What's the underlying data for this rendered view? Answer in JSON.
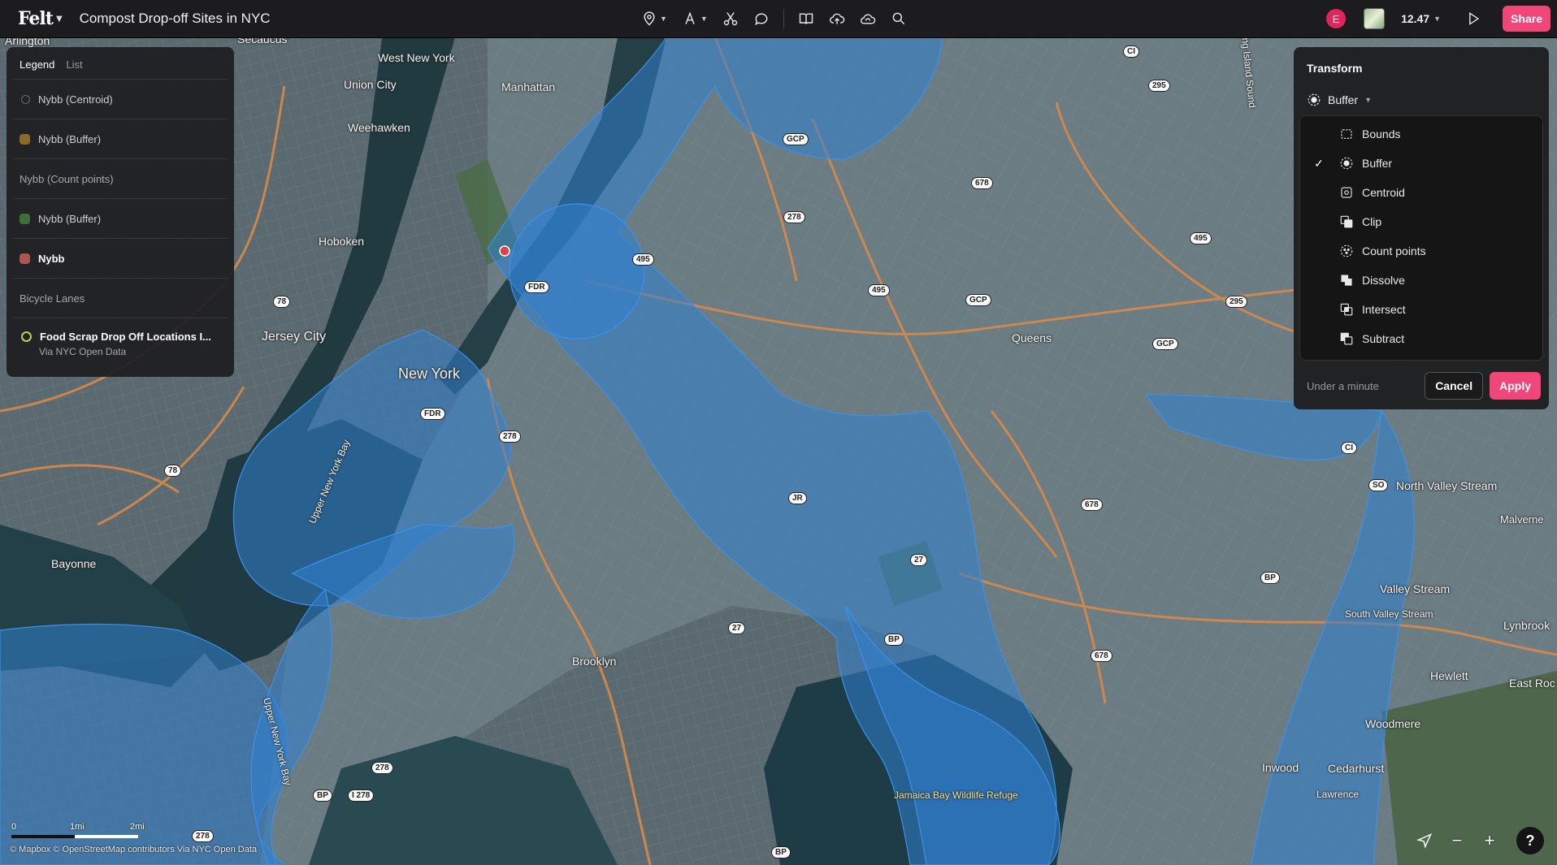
{
  "app": {
    "logo": "Felt",
    "map_title": "Compost Drop-off Sites in NYC"
  },
  "toolbar": {
    "icons": [
      "pin-icon",
      "text-icon",
      "scissors-icon",
      "comment-icon",
      "book-icon",
      "upload-icon",
      "cloud-icon",
      "search-icon"
    ]
  },
  "header_right": {
    "avatar_initial": "E",
    "zoom": "12.47",
    "share_label": "Share"
  },
  "legend": {
    "tabs": [
      {
        "label": "Legend",
        "active": true
      },
      {
        "label": "List",
        "active": false
      }
    ],
    "layers": [
      {
        "label": "Nybb (Centroid)",
        "swatch": "circle-outline"
      },
      {
        "label": "Nybb (Buffer)",
        "swatch": "#8a6a2a"
      },
      {
        "label": "Nybb (Count points)",
        "group": true
      },
      {
        "label": "Nybb (Buffer)",
        "swatch": "#3f6e3a"
      },
      {
        "label": "Nybb",
        "swatch": "#a8574d",
        "bold": true
      },
      {
        "label": "Bicycle Lanes",
        "group": true
      },
      {
        "label": "Food Scrap Drop Off Locations I...",
        "sub": "Via NYC Open Data",
        "swatch": "circle-green"
      }
    ]
  },
  "transform": {
    "title": "Transform",
    "selected_op": "Buffer",
    "operations": [
      {
        "label": "Bounds",
        "icon": "bounds-icon",
        "checked": false
      },
      {
        "label": "Buffer",
        "icon": "buffer-icon",
        "checked": true
      },
      {
        "label": "Centroid",
        "icon": "centroid-icon",
        "checked": false
      },
      {
        "label": "Clip",
        "icon": "clip-icon",
        "checked": false
      },
      {
        "label": "Count points",
        "icon": "count-points-icon",
        "checked": false
      },
      {
        "label": "Dissolve",
        "icon": "dissolve-icon",
        "checked": false
      },
      {
        "label": "Intersect",
        "icon": "intersect-icon",
        "checked": false
      },
      {
        "label": "Subtract",
        "icon": "subtract-icon",
        "checked": false
      }
    ],
    "duration": "Under a minute",
    "cancel_label": "Cancel",
    "apply_label": "Apply"
  },
  "map": {
    "places": [
      {
        "text": "Arlington"
      },
      {
        "text": "Secaucus"
      },
      {
        "text": "West New York"
      },
      {
        "text": "Union City"
      },
      {
        "text": "Manhattan"
      },
      {
        "text": "Weehawken"
      },
      {
        "text": "Hoboken"
      },
      {
        "text": "Jersey City"
      },
      {
        "text": "New York"
      },
      {
        "text": "Queens"
      },
      {
        "text": "Bayonne"
      },
      {
        "text": "Brooklyn"
      },
      {
        "text": "Upper New York Bay"
      },
      {
        "text": "Upper New York Bay"
      },
      {
        "text": "Long Island Sound"
      },
      {
        "text": "North Valley Stream"
      },
      {
        "text": "Malverne"
      },
      {
        "text": "Valley Stream"
      },
      {
        "text": "South Valley Stream"
      },
      {
        "text": "Lynbrook"
      },
      {
        "text": "Hewlett"
      },
      {
        "text": "East Roc"
      },
      {
        "text": "Woodmere"
      },
      {
        "text": "Inwood"
      },
      {
        "text": "Cedarhurst"
      },
      {
        "text": "Lawrence"
      },
      {
        "text": "Jamaica Bay Wildlife Refuge"
      }
    ],
    "shields": [
      "CI",
      "295",
      "GCP",
      "678",
      "278",
      "495",
      "FDR",
      "495",
      "495",
      "GCP",
      "295",
      "GCP",
      "78",
      "FDR",
      "278",
      "78",
      "JR",
      "678",
      "CI",
      "SO",
      "27",
      "BP",
      "27",
      "BP",
      "678",
      "BP",
      "278",
      "I 278",
      "278",
      "BP"
    ]
  },
  "scale": {
    "ticks": [
      "0",
      "1mi",
      "2mi"
    ]
  },
  "attribution": "© Mapbox  © OpenStreetMap contributors  Via NYC Open Data"
}
